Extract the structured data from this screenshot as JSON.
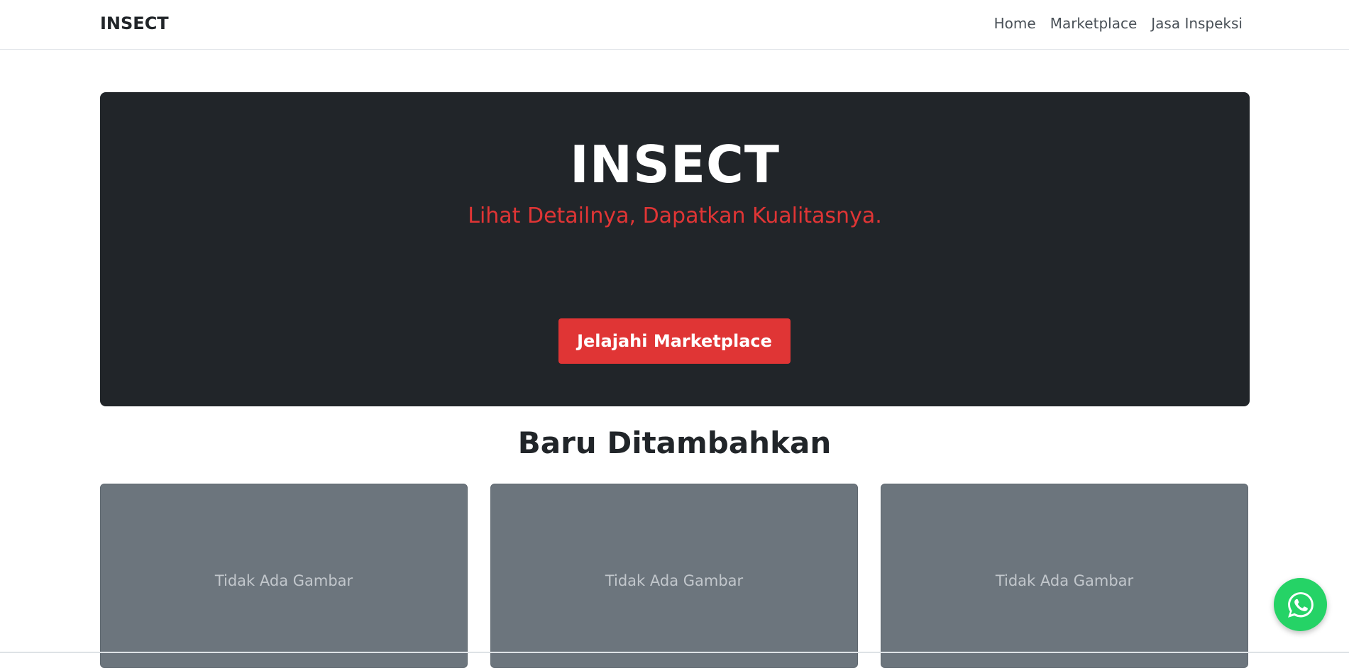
{
  "navbar": {
    "brand": "INSECT",
    "links": [
      "Home",
      "Marketplace",
      "Jasa Inspeksi"
    ]
  },
  "hero": {
    "title": "INSECT",
    "tagline": "Lihat Detailnya, Dapatkan Kualitasnya.",
    "cta_label": "Jelajahi Marketplace"
  },
  "section": {
    "title": "Baru Ditambahkan"
  },
  "cards": [
    {
      "placeholder": "Tidak Ada Gambar"
    },
    {
      "placeholder": "Tidak Ada Gambar"
    },
    {
      "placeholder": "Tidak Ada Gambar"
    }
  ],
  "floating": {
    "icon": "whatsapp-icon"
  },
  "colors": {
    "accent": "#e03535",
    "hero_bg": "#212529",
    "card_bg": "#6c757d",
    "whatsapp": "#25d366"
  }
}
